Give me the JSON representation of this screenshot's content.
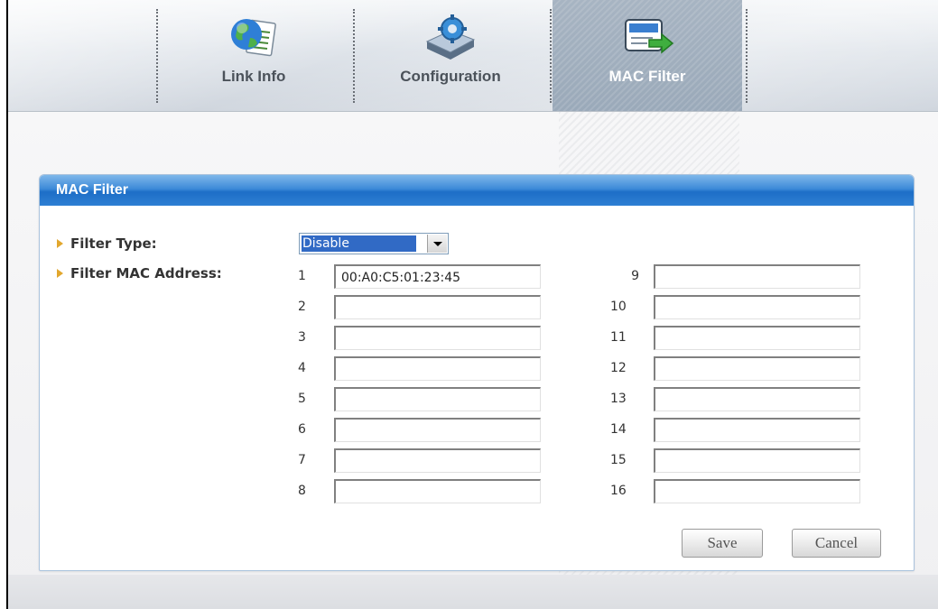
{
  "nav": {
    "tabs": [
      {
        "label": "Link Info",
        "icon": "globe-document-icon",
        "active": false
      },
      {
        "label": "Configuration",
        "icon": "gear-device-icon",
        "active": false
      },
      {
        "label": "MAC Filter",
        "icon": "filter-card-arrow-icon",
        "active": true
      }
    ]
  },
  "panel": {
    "title": "MAC Filter",
    "filter_type_label": "Filter Type:",
    "filter_type_value": "Disable",
    "filter_mac_label": "Filter MAC Address:",
    "entries": [
      {
        "index": "1",
        "value": "00:A0:C5:01:23:45"
      },
      {
        "index": "2",
        "value": ""
      },
      {
        "index": "3",
        "value": ""
      },
      {
        "index": "4",
        "value": ""
      },
      {
        "index": "5",
        "value": ""
      },
      {
        "index": "6",
        "value": ""
      },
      {
        "index": "7",
        "value": ""
      },
      {
        "index": "8",
        "value": ""
      },
      {
        "index": "9",
        "value": ""
      },
      {
        "index": "10",
        "value": ""
      },
      {
        "index": "11",
        "value": ""
      },
      {
        "index": "12",
        "value": ""
      },
      {
        "index": "13",
        "value": ""
      },
      {
        "index": "14",
        "value": ""
      },
      {
        "index": "15",
        "value": ""
      },
      {
        "index": "16",
        "value": ""
      }
    ],
    "save_label": "Save",
    "cancel_label": "Cancel"
  },
  "colors": {
    "header_blue": "#2e7fd3",
    "active_tab": "#9aa9b9",
    "bullet": "#e2a72e",
    "selection": "#316ac5"
  }
}
